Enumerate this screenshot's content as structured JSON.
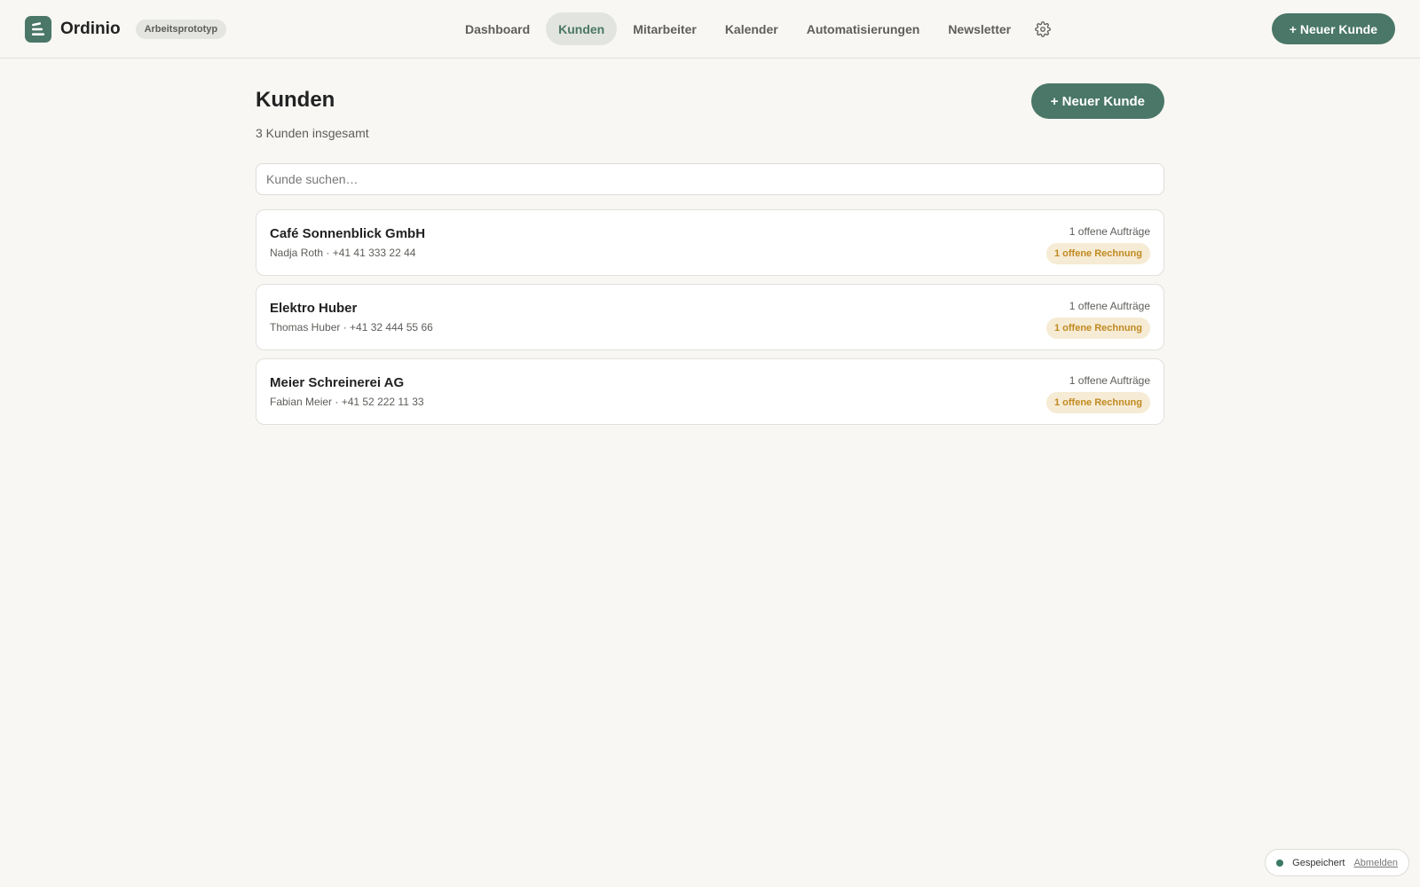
{
  "app": {
    "name": "Ordinio",
    "badge": "Arbeitsprototyp"
  },
  "nav": {
    "items": [
      {
        "label": "Dashboard",
        "active": false
      },
      {
        "label": "Kunden",
        "active": true
      },
      {
        "label": "Mitarbeiter",
        "active": false
      },
      {
        "label": "Kalender",
        "active": false
      },
      {
        "label": "Automatisierungen",
        "active": false
      },
      {
        "label": "Newsletter",
        "active": false
      }
    ],
    "settings_icon": "gear-icon"
  },
  "header": {
    "new_customer_label": "+ Neuer Kunde"
  },
  "page": {
    "title": "Kunden",
    "subtitle": "3 Kunden insgesamt",
    "new_customer_label": "+ Neuer Kunde"
  },
  "search": {
    "placeholder": "Kunde suchen…",
    "value": ""
  },
  "customers": [
    {
      "name": "Café Sonnenblick GmbH",
      "contact": "Nadja Roth · +41 41 333 22 44",
      "orders": "1 offene Aufträge",
      "invoice": "1 offene Rechnung"
    },
    {
      "name": "Elektro Huber",
      "contact": "Thomas Huber · +41 32 444 55 66",
      "orders": "1 offene Aufträge",
      "invoice": "1 offene Rechnung"
    },
    {
      "name": "Meier Schreinerei AG",
      "contact": "Fabian Meier · +41 52 222 11 33",
      "orders": "1 offene Aufträge",
      "invoice": "1 offene Rechnung"
    }
  ],
  "status": {
    "text": "Gespeichert",
    "logout_label": "Abmelden"
  },
  "colors": {
    "accent": "#4a7767",
    "background": "#f8f7f4",
    "invoice_badge_bg": "#f6ebd4",
    "invoice_badge_text": "#c08a22",
    "status_dot": "#3c7a63"
  }
}
